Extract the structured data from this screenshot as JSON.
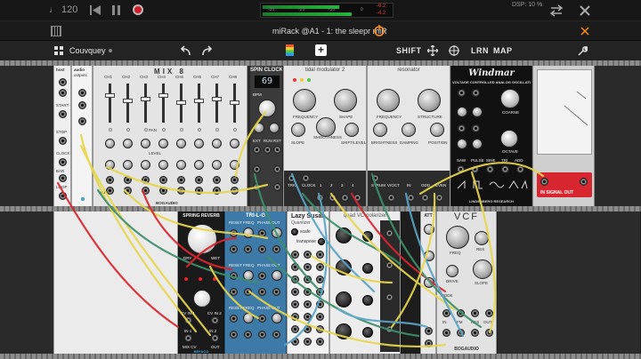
{
  "host": {
    "tempo": "♩ 120",
    "meter_ticks": [
      "-30",
      "-20",
      "-10",
      "0"
    ],
    "meter_vals": [
      "-6.2",
      "-4.2"
    ],
    "dsp": "DSP: 10 %"
  },
  "window": {
    "title": "miRack @A1 - 1: the sleepr miR"
  },
  "toolbar": {
    "patch_name": "Couvquey",
    "shift": "SHIFT",
    "lrn": "LRN",
    "map": "MAP"
  },
  "modules": {
    "tool": {
      "labels": [
        "host",
        "audio",
        "outputs",
        "START",
        "STOP",
        "CLOCK",
        "BAR",
        "LOOP"
      ]
    },
    "mix8": {
      "title": "MIX 8",
      "channels": [
        "CH1",
        "CH2",
        "CH3",
        "CH4",
        "CH5",
        "CH6",
        "CH7",
        "CH8"
      ],
      "mute": "MUTE",
      "pan": "PAN",
      "level": "LEVEL",
      "brand": "BOGAUDIO"
    },
    "spin": {
      "title": "SPIN CLOCK",
      "display": "69",
      "bpm": "BPM",
      "ext": "EXT",
      "run": "RUN",
      "rst": "RST"
    },
    "tidal": {
      "title": "tidal modulator 2",
      "labels": [
        "FREQUENCY",
        "SHAPE",
        "SLOPE",
        "SMOOTHNESS",
        "SHIFT/LEVEL"
      ],
      "bottom": [
        "TRIG",
        "CLOCK",
        "1",
        "2",
        "3",
        "4"
      ]
    },
    "resonator": {
      "title": "resonator",
      "labels": [
        "FREQUENCY",
        "STRUCTURE",
        "BRIGHTNESS",
        "DAMPING",
        "POSITION"
      ],
      "bottom": [
        "STRUM",
        "V/OCT",
        "IN",
        "ODD",
        "EVEN"
      ]
    },
    "wintermute": {
      "title": "Windmar",
      "subtitle": "VOLTAGE CONTROLLED ANALOG OSCILLATOR",
      "knobs": [
        "COARSE",
        "OCTAVE"
      ],
      "waves": [
        "SAW",
        "PULSE",
        "SINE",
        "TRI",
        "ADD"
      ],
      "brand": "LINDENBERG RESEARCH"
    },
    "scope": {
      "label": "IN SIGNAL OUT"
    },
    "reverb": {
      "title": "SPRING REVERB",
      "dry": "DRY",
      "wet": "WET",
      "inputs": [
        "IN 1",
        "IN 2"
      ],
      "cv": [
        "CV IN 1",
        "CV IN 2"
      ],
      "mixcv": "MIX CV",
      "out": "OUT",
      "brand": "BEFACO"
    },
    "trilfo": {
      "title": "TRI-L-G",
      "labels": [
        "RESET",
        "FREQ",
        "PHASE",
        "OUT"
      ]
    },
    "lazy": {
      "title": "Lazy Susan",
      "sub": "Quantizer",
      "labels": [
        "scale",
        "transpose"
      ]
    },
    "quadvc": {
      "title": "quad VC-polarizer"
    },
    "vcf": {
      "title": "VCF",
      "labels": [
        "FREQ",
        "RES",
        "SLOPE",
        "DRIVE",
        "MODE"
      ],
      "ports": [
        "IN",
        "OUT",
        "FM",
        "RES"
      ],
      "brand": "BOGAUDIO"
    },
    "att": {
      "title": "ATT"
    }
  },
  "colors": {
    "accent_orange": "#ff8c1a",
    "panel_light": "#e4e4e4",
    "panel_blue": "#3d7aa8",
    "panel_dark": "#111111",
    "cable_yellow": "#e8d64a",
    "cable_red": "#d9262e",
    "cable_green": "#3c8f6b",
    "cable_blue": "#5aa4c8"
  },
  "icons": [
    "grid-icon",
    "undo-icon",
    "redo-icon",
    "palette-icon",
    "add-icon",
    "move-icon",
    "target-icon",
    "wrench-icon",
    "close-icon",
    "power-icon",
    "rewind-icon",
    "pause-icon",
    "record-icon",
    "chevron-icon"
  ]
}
